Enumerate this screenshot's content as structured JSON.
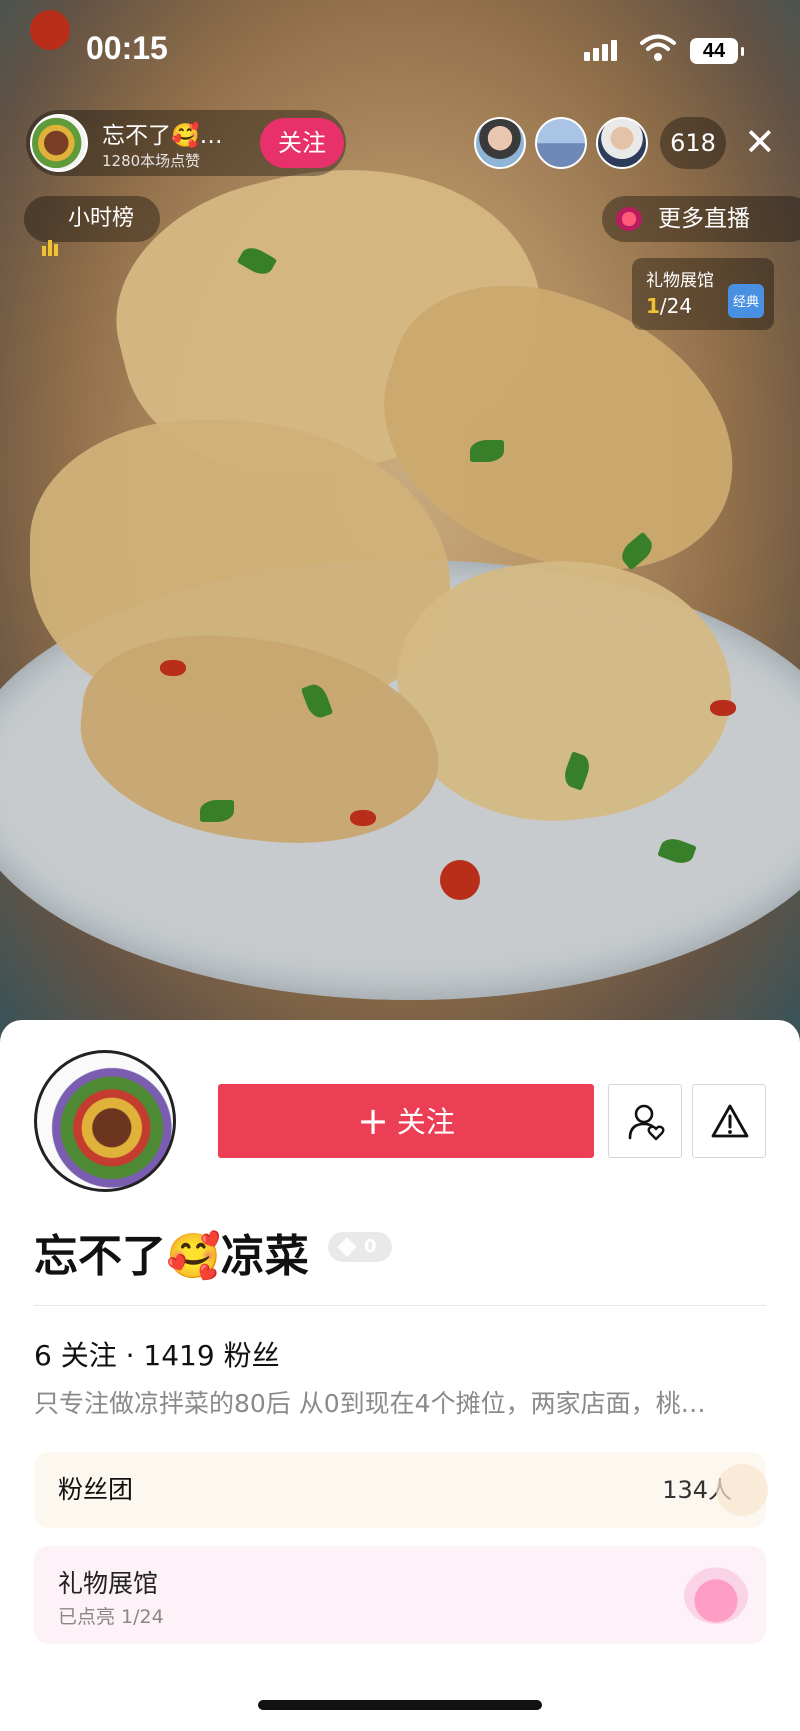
{
  "status_bar": {
    "time": "00:15",
    "battery": "44"
  },
  "live_header": {
    "host_name": "忘不了🥰…",
    "likes": "1280本场点赞",
    "follow_label": "关注",
    "viewer_count": "618",
    "close_glyph": "✕",
    "hour_rank_label": "小时榜",
    "more_live_label": "更多直播",
    "gift_hall": {
      "title": "礼物展馆",
      "current": "1",
      "total": "/24",
      "badge": "经典"
    }
  },
  "profile_sheet": {
    "follow_button_label": "关注",
    "name": "忘不了🥰凉菜",
    "level": "0",
    "stats": "6 关注 · 1419 粉丝",
    "bio": "只专注做凉拌菜的80后 从0到现在4个摊位，两家店面，桃…",
    "fan_club": {
      "label": "粉丝团",
      "count": "134人"
    },
    "gift_hall": {
      "title": "礼物展馆",
      "subtitle": "已点亮 1/24"
    }
  },
  "icons": [
    "signal-icon",
    "wifi-icon",
    "battery-icon",
    "close-icon",
    "rank-bars-icon",
    "live-dot-icon",
    "plus-icon",
    "friend-heart-icon",
    "warning-icon",
    "heart-icon",
    "gift-cup-icon"
  ],
  "colors": {
    "follow_red": "#ec3e55",
    "live_pink": "#e8306a",
    "rank_gold": "#f1c232"
  }
}
